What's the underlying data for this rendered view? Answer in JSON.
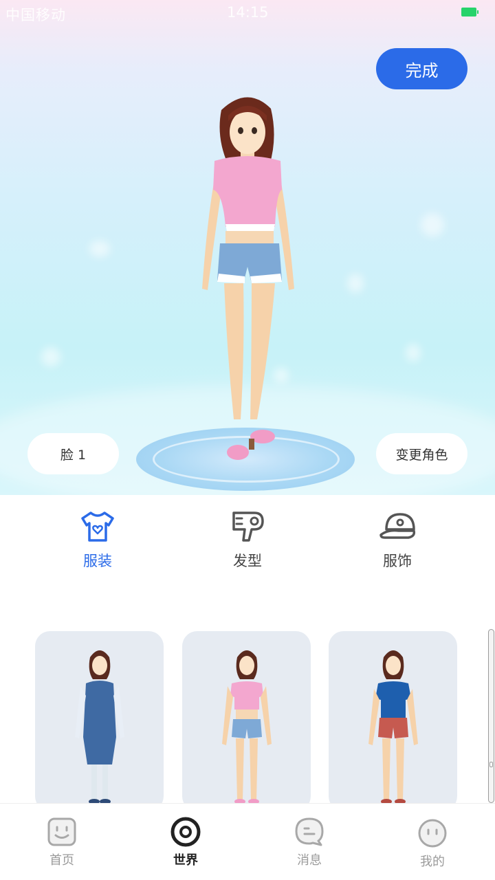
{
  "status_bar": {
    "carrier": "中国移动",
    "time": "14:15"
  },
  "stage": {
    "done_label": "完成",
    "face_label": "脸 1",
    "change_role_label": "变更角色"
  },
  "categories": [
    {
      "label": "服装",
      "icon": "tshirt-icon",
      "active": true
    },
    {
      "label": "发型",
      "icon": "hair-dryer-icon",
      "active": false
    },
    {
      "label": "服饰",
      "icon": "cap-icon",
      "active": false
    }
  ],
  "outfits": [
    {
      "name": "blue-dress-outfit"
    },
    {
      "name": "pink-top-shorts-outfit"
    },
    {
      "name": "blue-tee-red-shorts-outfit"
    }
  ],
  "bottom_nav": [
    {
      "label": "首页",
      "icon": "home-face-icon",
      "active": false
    },
    {
      "label": "世界",
      "icon": "world-ring-icon",
      "active": true
    },
    {
      "label": "消息",
      "icon": "message-bubble-icon",
      "active": false
    },
    {
      "label": "我的",
      "icon": "profile-face-icon",
      "active": false
    }
  ],
  "colors": {
    "accent": "#2b6be8",
    "inactive": "#9a9a9a",
    "card_bg": "#e6ebf2"
  }
}
